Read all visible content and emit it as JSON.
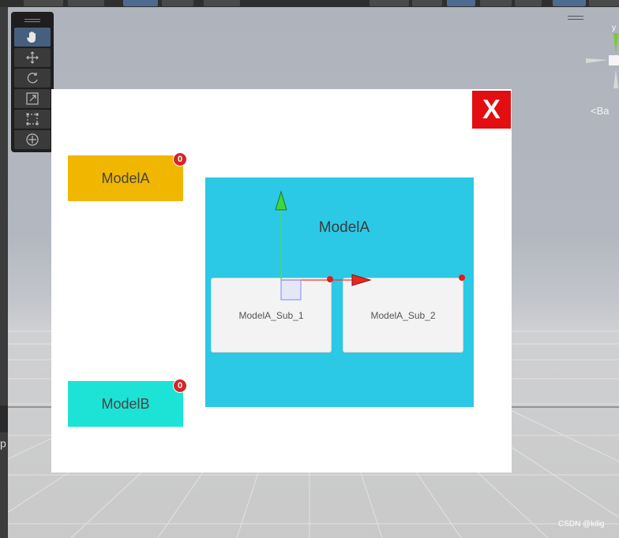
{
  "scene": {
    "sky_color": "#b3b8c0",
    "floor_color": "#cfd0d2",
    "grid_color": "#e6e6e6"
  },
  "tools": [
    {
      "name": "hand-tool",
      "icon": "hand-icon",
      "active": true
    },
    {
      "name": "move-tool",
      "icon": "move-icon",
      "active": false
    },
    {
      "name": "rotate-tool",
      "icon": "rotate-icon",
      "active": false
    },
    {
      "name": "scale-tool",
      "icon": "scale-icon",
      "active": false
    },
    {
      "name": "rect-tool",
      "icon": "rect-transform-icon",
      "active": false
    },
    {
      "name": "transform-tool",
      "icon": "transform-icon",
      "active": false
    }
  ],
  "gizmo": {
    "axis_label": "y",
    "view_label": "Ba",
    "back_prefix": "<"
  },
  "panel": {
    "close_label": "X",
    "close_color": "#e30e12",
    "buttons": [
      {
        "label": "ModelA",
        "badge": "0",
        "color": "#f1b600"
      },
      {
        "label": "ModelB",
        "badge": "0",
        "color": "#1de3d6"
      }
    ],
    "selected_area": {
      "title": "ModelA",
      "color": "#2bc9e5",
      "children": [
        {
          "label": "ModelA_Sub_1"
        },
        {
          "label": "ModelA_Sub_2"
        }
      ]
    }
  },
  "left_edge_glyph": "p",
  "watermark": "CSDN @kilig"
}
